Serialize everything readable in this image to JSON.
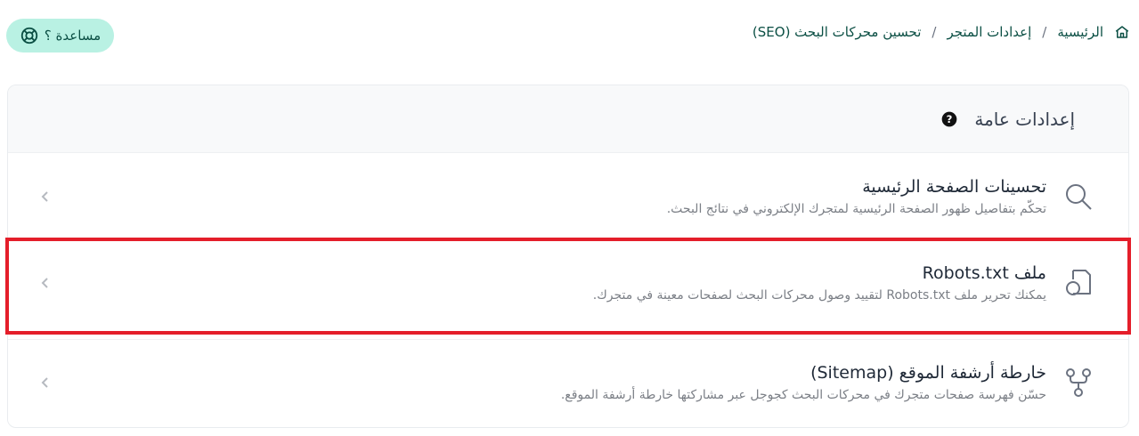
{
  "header": {
    "help_label": "مساعدة ؟",
    "breadcrumb": {
      "home": "الرئيسية",
      "store_settings": "إعدادات المتجر",
      "current": "تحسين محركات البحث (SEO)",
      "separator": "/"
    }
  },
  "card": {
    "title": "إعدادات عامة",
    "items": [
      {
        "title": "تحسينات الصفحة الرئيسية",
        "description": "تحكّم بتفاصيل ظهور الصفحة الرئيسية لمتجرك الإلكتروني في نتائج البحث.",
        "icon": "search-icon"
      },
      {
        "title": "ملف Robots.txt",
        "description": "يمكنك تحرير ملف Robots.txt لتقييد وصول محركات البحث لصفحات معينة في متجرك.",
        "icon": "file-search-icon"
      },
      {
        "title": "خارطة أرشفة الموقع (Sitemap)",
        "description": "حسّن فهرسة صفحات متجرك في محركات البحث كجوجل عبر مشاركتها خارطة أرشفة الموقع.",
        "icon": "sitemap-icon"
      }
    ]
  },
  "colors": {
    "accent": "#0b4f44",
    "help_bg": "#b9f1e3",
    "highlight": "#e41e2a"
  }
}
